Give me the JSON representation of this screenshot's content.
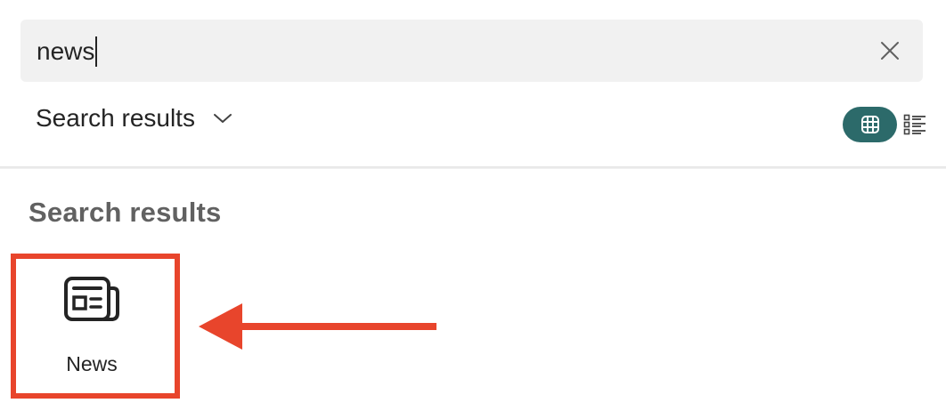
{
  "search": {
    "query": "news"
  },
  "scope": {
    "selected": "Search results"
  },
  "view_toggle": {
    "active": "grid",
    "accent_color": "#2c6a6a"
  },
  "results": {
    "heading": "Search results",
    "items": [
      {
        "label": "News",
        "icon": "newspaper-icon"
      }
    ]
  },
  "annotation": {
    "color": "#e8452c",
    "target": "News"
  }
}
